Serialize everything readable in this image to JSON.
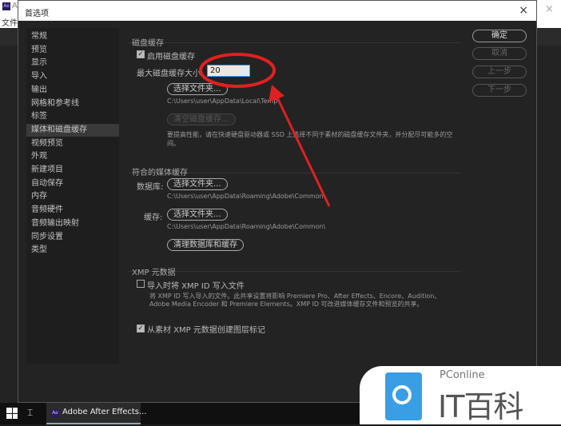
{
  "app": {
    "title_fragment": "A",
    "menu_fragment": "文件",
    "icon": "ae-icon"
  },
  "dialog": {
    "title": "首选项",
    "close": "×"
  },
  "sidebar": {
    "items": [
      {
        "label": "常规"
      },
      {
        "label": "预览"
      },
      {
        "label": "显示"
      },
      {
        "label": "导入"
      },
      {
        "label": "输出"
      },
      {
        "label": "网格和参考线"
      },
      {
        "label": "标签"
      },
      {
        "label": "媒体和磁盘缓存",
        "selected": true
      },
      {
        "label": "视频预览"
      },
      {
        "label": "外观"
      },
      {
        "label": "新建项目"
      },
      {
        "label": "自动保存"
      },
      {
        "label": "内存"
      },
      {
        "label": "音频硬件"
      },
      {
        "label": "音频输出映射"
      },
      {
        "label": "同步设置"
      },
      {
        "label": "类型"
      }
    ]
  },
  "buttons": {
    "ok": "确定",
    "cancel": "取消",
    "prev": "上一步",
    "next": "下一步"
  },
  "disk_cache": {
    "title": "磁盘缓存",
    "enable_label": "启用磁盘缓存",
    "enabled": true,
    "max_size_label": "最大磁盘缓存大小",
    "max_size_value": "20",
    "choose_folder": "选择文件夹...",
    "path": "C:\\Users\\user\\AppData\\Local\\Temp",
    "clear": "清空磁盘缓存...",
    "hint": "要提高性能，请在快速硬盘驱动器或 SSD 上选择不同于素材的磁盘缓存文件夹，并分配尽可能多的空间。"
  },
  "media_cache": {
    "title": "符合的媒体缓存",
    "db_label": "数据库:",
    "db_choose": "选择文件夹...",
    "db_path": "C:\\Users\\user\\AppData\\Roaming\\Adobe\\Common\\",
    "cache_label": "缓存:",
    "cache_choose": "选择文件夹...",
    "cache_path": "C:\\Users\\user\\AppData\\Roaming\\Adobe\\Common\\",
    "clean": "清理数据库和缓存"
  },
  "xmp": {
    "title": "XMP 元数据",
    "write_label": "导入时将 XMP ID 写入文件",
    "write_checked": false,
    "write_desc1": "将 XMP ID 写入导入的文件。此共享设置将影响 Premiere Pro、After Effects、Encore、Audition、",
    "write_desc2": "Adobe Media Encoder 和 Premiere Elements。XMP ID 可改进媒体缓存文件和预览的共享。",
    "markers_label": "从素材 XMP 元数据创建图层标记",
    "markers_checked": true
  },
  "taskbar": {
    "app_label": "Adobe After Effects..."
  },
  "watermark": {
    "brand": "PConline",
    "name": "IT百科"
  },
  "colors": {
    "annotation": "#e02020",
    "logo_blue": "#3a9ee4"
  }
}
